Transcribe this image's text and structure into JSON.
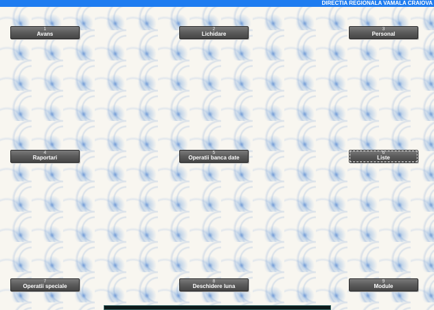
{
  "header": {
    "title": "DIRECTIA REGIONALA VAMALA CRAIOVA"
  },
  "menu": [
    {
      "number": "1",
      "label": "Avans"
    },
    {
      "number": "2",
      "label": "Lichidare"
    },
    {
      "number": "3",
      "label": "Personal"
    },
    {
      "number": "4",
      "label": "Raportari"
    },
    {
      "number": "5",
      "label": "Operatii banca date"
    },
    {
      "number": "6",
      "label": "Liste"
    },
    {
      "number": "7",
      "label": "Operatii speciale"
    },
    {
      "number": "8",
      "label": "Deschidere luna"
    },
    {
      "number": "9",
      "label": "Module"
    }
  ],
  "colors": {
    "titlebar": "#1e7cf0",
    "button": "#5d5d5d",
    "button_text": "#ffffff"
  }
}
